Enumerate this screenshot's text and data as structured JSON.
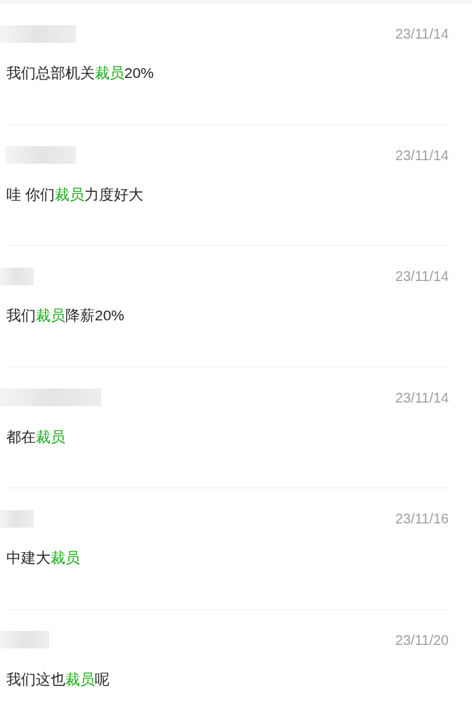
{
  "comments": [
    {
      "date": "23/11/14",
      "text": [
        {
          "text": "我们总部机关",
          "highlighted": false
        },
        {
          "text": "裁员",
          "highlighted": true
        },
        {
          "text": "20%",
          "highlighted": false
        }
      ]
    },
    {
      "date": "23/11/14",
      "text": [
        {
          "text": "哇 你们",
          "highlighted": false
        },
        {
          "text": "裁员",
          "highlighted": true
        },
        {
          "text": "力度好大",
          "highlighted": false
        }
      ]
    },
    {
      "date": "23/11/14",
      "text": [
        {
          "text": "我们",
          "highlighted": false
        },
        {
          "text": "裁员",
          "highlighted": true
        },
        {
          "text": "降薪20%",
          "highlighted": false
        }
      ]
    },
    {
      "date": "23/11/14",
      "text": [
        {
          "text": "都在",
          "highlighted": false
        },
        {
          "text": "裁员",
          "highlighted": true
        }
      ]
    },
    {
      "date": "23/11/16",
      "text": [
        {
          "text": "中建大",
          "highlighted": false
        },
        {
          "text": "裁员",
          "highlighted": true
        }
      ]
    },
    {
      "date": "23/11/20",
      "text": [
        {
          "text": "我们这也",
          "highlighted": false
        },
        {
          "text": "裁员",
          "highlighted": true
        },
        {
          "text": "呢",
          "highlighted": false
        }
      ]
    }
  ]
}
